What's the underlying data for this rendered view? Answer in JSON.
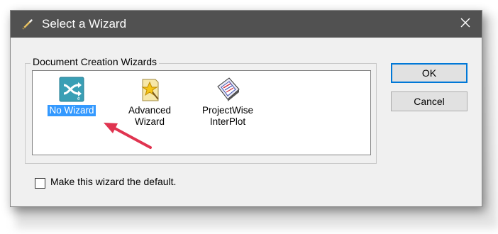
{
  "window": {
    "title": "Select a Wizard",
    "title_icon": "pencil-icon",
    "close_icon": "close-icon"
  },
  "group": {
    "legend": "Document Creation Wizards"
  },
  "wizards": [
    {
      "label_line1": "No Wizard",
      "label_line2": "",
      "icon": "no-wizard-crossed-arrows-icon",
      "selected": true
    },
    {
      "label_line1": "Advanced",
      "label_line2": "Wizard",
      "icon": "advanced-wizard-star-icon",
      "selected": false
    },
    {
      "label_line1": "ProjectWise",
      "label_line2": "InterPlot",
      "icon": "projectwise-interplot-icon",
      "selected": false
    }
  ],
  "buttons": {
    "ok": "OK",
    "cancel": "Cancel"
  },
  "default_checkbox": {
    "label": "Make this wizard the default.",
    "checked": false
  },
  "annotation": {
    "arrow_color": "#e03450",
    "points_to": "No Wizard"
  },
  "colors": {
    "titlebar": "#515151",
    "selection": "#3399ff",
    "dialog_bg": "#f0f0f0"
  }
}
